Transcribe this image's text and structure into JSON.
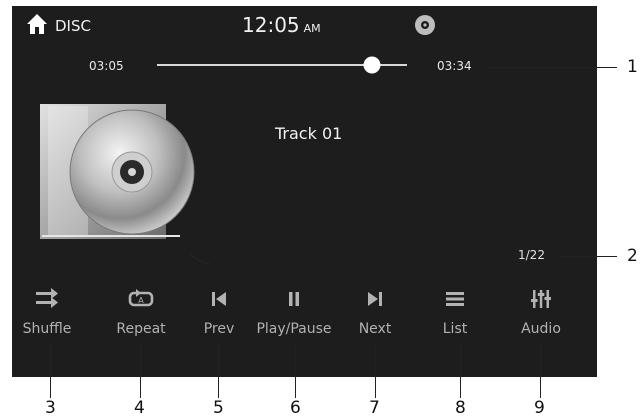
{
  "status_bar": {
    "source": "DISC",
    "time": "12:05",
    "ampm": "AM"
  },
  "playback": {
    "elapsed": "03:05",
    "total": "03:34",
    "progress_fraction": 0.86,
    "track_title": "Track 01",
    "track_count": "1/22"
  },
  "controls": [
    {
      "label": "Shuffle",
      "icon": "shuffle-icon"
    },
    {
      "label": "Repeat",
      "icon": "repeat-icon"
    },
    {
      "label": "Prev",
      "icon": "prev-icon"
    },
    {
      "label": "Play/Pause",
      "icon": "play-pause-icon"
    },
    {
      "label": "Next",
      "icon": "next-icon"
    },
    {
      "label": "List",
      "icon": "list-icon"
    },
    {
      "label": "Audio",
      "icon": "audio-eq-icon"
    }
  ],
  "callouts": [
    "1",
    "2",
    "3",
    "4",
    "5",
    "6",
    "7",
    "8",
    "9"
  ]
}
